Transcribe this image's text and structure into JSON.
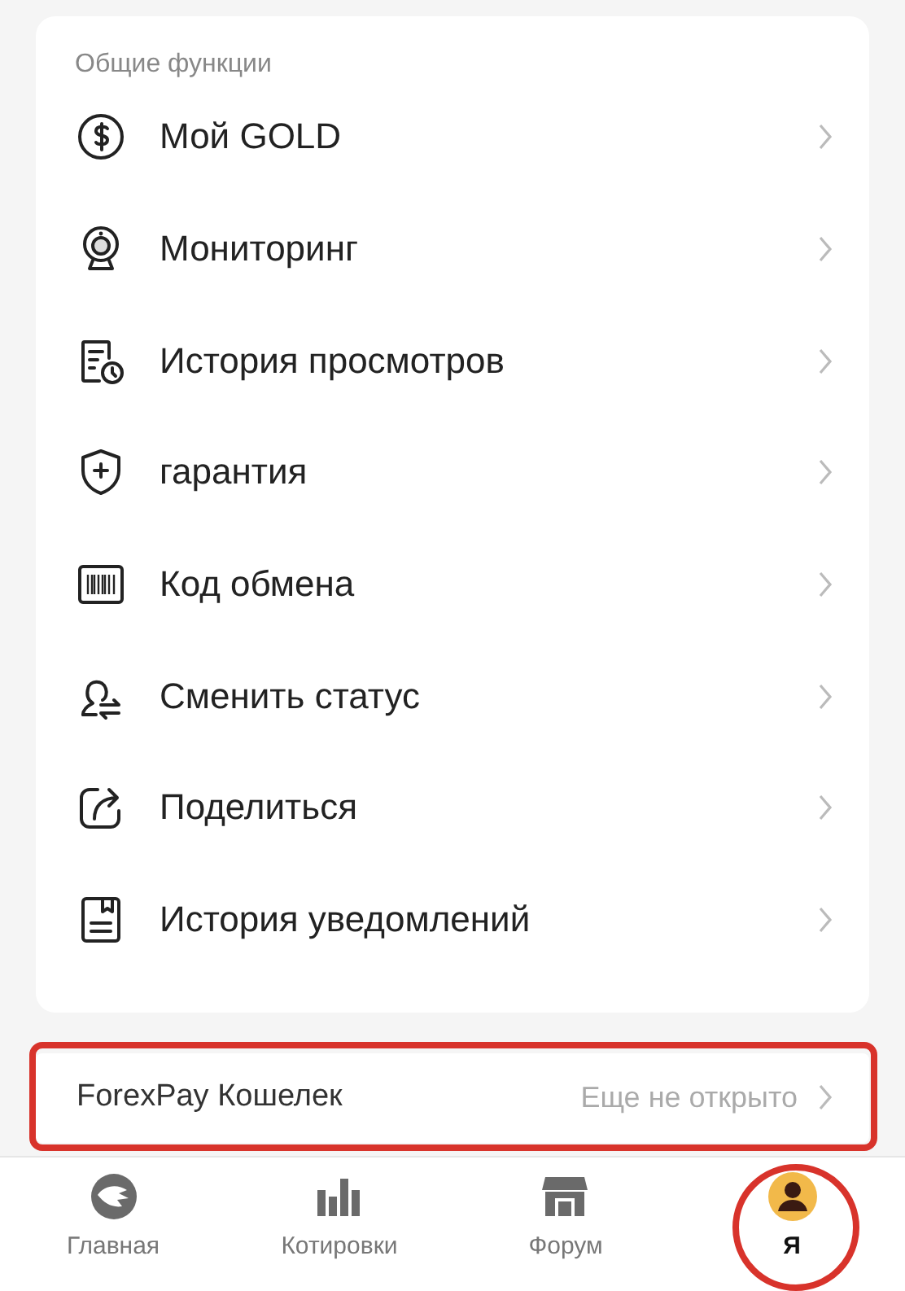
{
  "section": {
    "title": "Общие функции",
    "items": [
      {
        "label": "Мой GOLD"
      },
      {
        "label": "Мониторинг"
      },
      {
        "label": "История просмотров"
      },
      {
        "label": "гарантия"
      },
      {
        "label": "Код обмена"
      },
      {
        "label": "Сменить статус"
      },
      {
        "label": "Поделиться"
      },
      {
        "label": "История уведомлений"
      }
    ]
  },
  "wallet": {
    "label": "ForexPay Кошелек",
    "status": "Еще не открыто",
    "highlighted": true
  },
  "tabs": [
    {
      "label": "Главная",
      "selected": false,
      "highlighted": false
    },
    {
      "label": "Котировки",
      "selected": false,
      "highlighted": false
    },
    {
      "label": "Форум",
      "selected": false,
      "highlighted": false
    },
    {
      "label": "Я",
      "selected": true,
      "highlighted": true
    }
  ]
}
